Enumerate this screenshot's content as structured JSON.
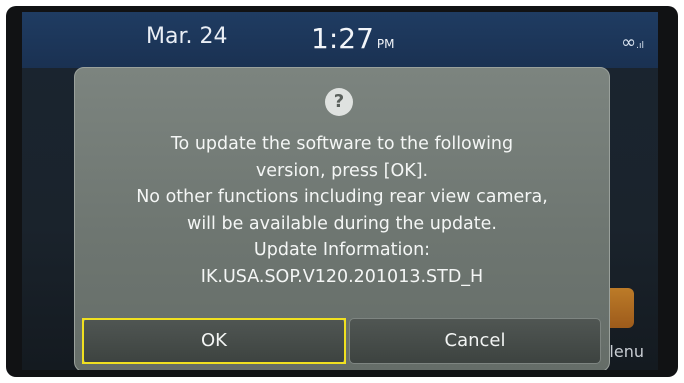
{
  "status_bar": {
    "date": "Mar. 24",
    "time": "1:27",
    "ampm": "PM",
    "signal_icon": "infinity-signal-icon"
  },
  "background": {
    "menu_label_partial": "lenu"
  },
  "dialog": {
    "icon": "question-icon",
    "icon_glyph": "?",
    "lines": [
      "To update the software to the following",
      "version, press [OK].",
      "No other functions including rear view camera,",
      "will be available during the update.",
      "Update Information:",
      "IK.USA.SOP.V120.201013.STD_H"
    ],
    "ok_label": "OK",
    "cancel_label": "Cancel"
  },
  "colors": {
    "highlight": "#f0e020",
    "status_bar": "#1f3c62",
    "dialog_bg": "#737b76"
  }
}
